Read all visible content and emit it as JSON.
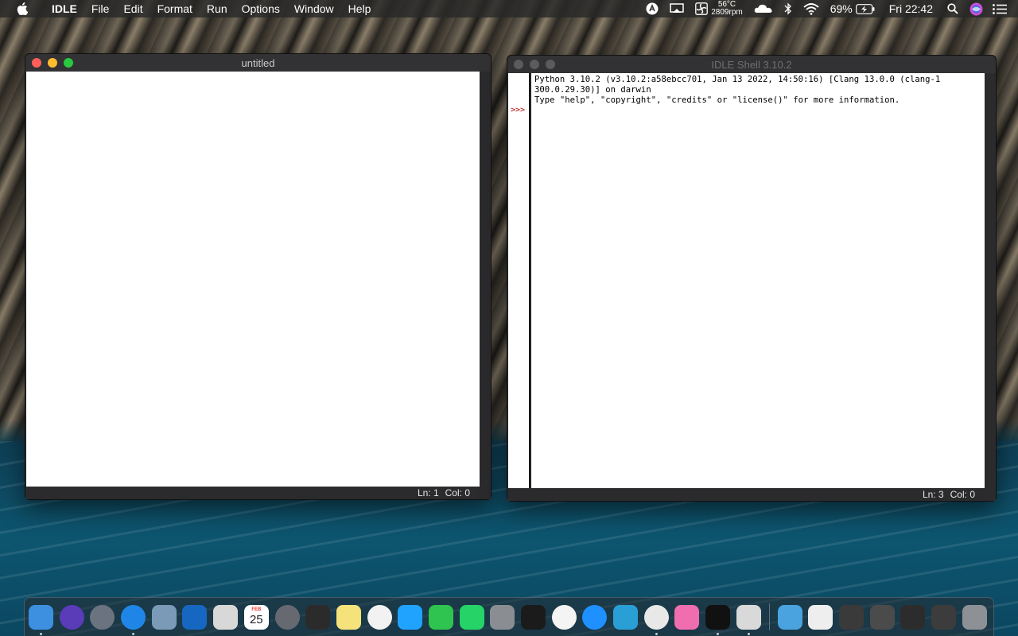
{
  "menubar": {
    "app_name": "IDLE",
    "menus": [
      "File",
      "Edit",
      "Format",
      "Run",
      "Options",
      "Window",
      "Help"
    ],
    "temperature": "56°C",
    "fan_speed": "2809rpm",
    "battery": "69%",
    "clock": "Fri 22:42"
  },
  "editor_window": {
    "title": "untitled",
    "status_ln": "Ln: 1",
    "status_col": "Col: 0",
    "traffic_lights": [
      "#ff5f57",
      "#febc2e",
      "#28c840"
    ]
  },
  "shell_window": {
    "title": "IDLE Shell 3.10.2",
    "prompt": ">>>",
    "lines": [
      "Python 3.10.2 (v3.10.2:a58ebcc701, Jan 13 2022, 14:50:16) [Clang 13.0.0 (clang-1",
      "300.0.29.30)] on darwin",
      "Type \"help\", \"copyright\", \"credits\" or \"license()\" for more information."
    ],
    "status_ln": "Ln: 3",
    "status_col": "Col: 0"
  },
  "dock": {
    "calendar_month": "FEB",
    "calendar_day": "25",
    "apps": [
      {
        "name": "finder-icon",
        "color": "#3d8fe0"
      },
      {
        "name": "siri-icon",
        "color": "#5a3bb8"
      },
      {
        "name": "launchpad-icon",
        "color": "#6c7380"
      },
      {
        "name": "safari-icon",
        "color": "#1f86e8"
      },
      {
        "name": "preview-icon",
        "color": "#7a9ab8"
      },
      {
        "name": "outlook-icon",
        "color": "#1667c1"
      },
      {
        "name": "screenshot-icon",
        "color": "#d8d8d8"
      },
      {
        "name": "calendar-icon",
        "color": "#ffffff"
      },
      {
        "name": "disk-utility-icon",
        "color": "#666a70"
      },
      {
        "name": "final-cut-icon",
        "color": "#2b2b2b"
      },
      {
        "name": "notes-icon",
        "color": "#f5e27a"
      },
      {
        "name": "photos-icon",
        "color": "#f2f2f2"
      },
      {
        "name": "messages-icon",
        "color": "#1fa3ff"
      },
      {
        "name": "facetime-icon",
        "color": "#2fc34f"
      },
      {
        "name": "whatsapp-icon",
        "color": "#25d366"
      },
      {
        "name": "system-preferences-icon",
        "color": "#8a8d92"
      },
      {
        "name": "activity-monitor-icon",
        "color": "#1b1b1b"
      },
      {
        "name": "music-icon",
        "color": "#f4f4f4"
      },
      {
        "name": "app-store-icon",
        "color": "#1e90ff"
      },
      {
        "name": "app-8-icon",
        "color": "#2a9fd6"
      },
      {
        "name": "chrome-icon",
        "color": "#e8e8e8"
      },
      {
        "name": "pink-app-icon",
        "color": "#f06db0"
      },
      {
        "name": "spiral-app-icon",
        "color": "#111111"
      },
      {
        "name": "python-launcher-icon",
        "color": "#d9d9d9"
      }
    ],
    "folders": [
      {
        "name": "downloads-folder-icon",
        "color": "#4aa3df"
      },
      {
        "name": "document-icon",
        "color": "#eeeeee"
      },
      {
        "name": "window-thumb-1-icon",
        "color": "#3a3a3a"
      },
      {
        "name": "window-thumb-2-icon",
        "color": "#4b4b4b"
      },
      {
        "name": "window-thumb-3-icon",
        "color": "#2c2c2c"
      },
      {
        "name": "window-thumb-4-icon",
        "color": "#3c3c3c"
      },
      {
        "name": "trash-icon",
        "color": "#8d9196"
      }
    ]
  }
}
